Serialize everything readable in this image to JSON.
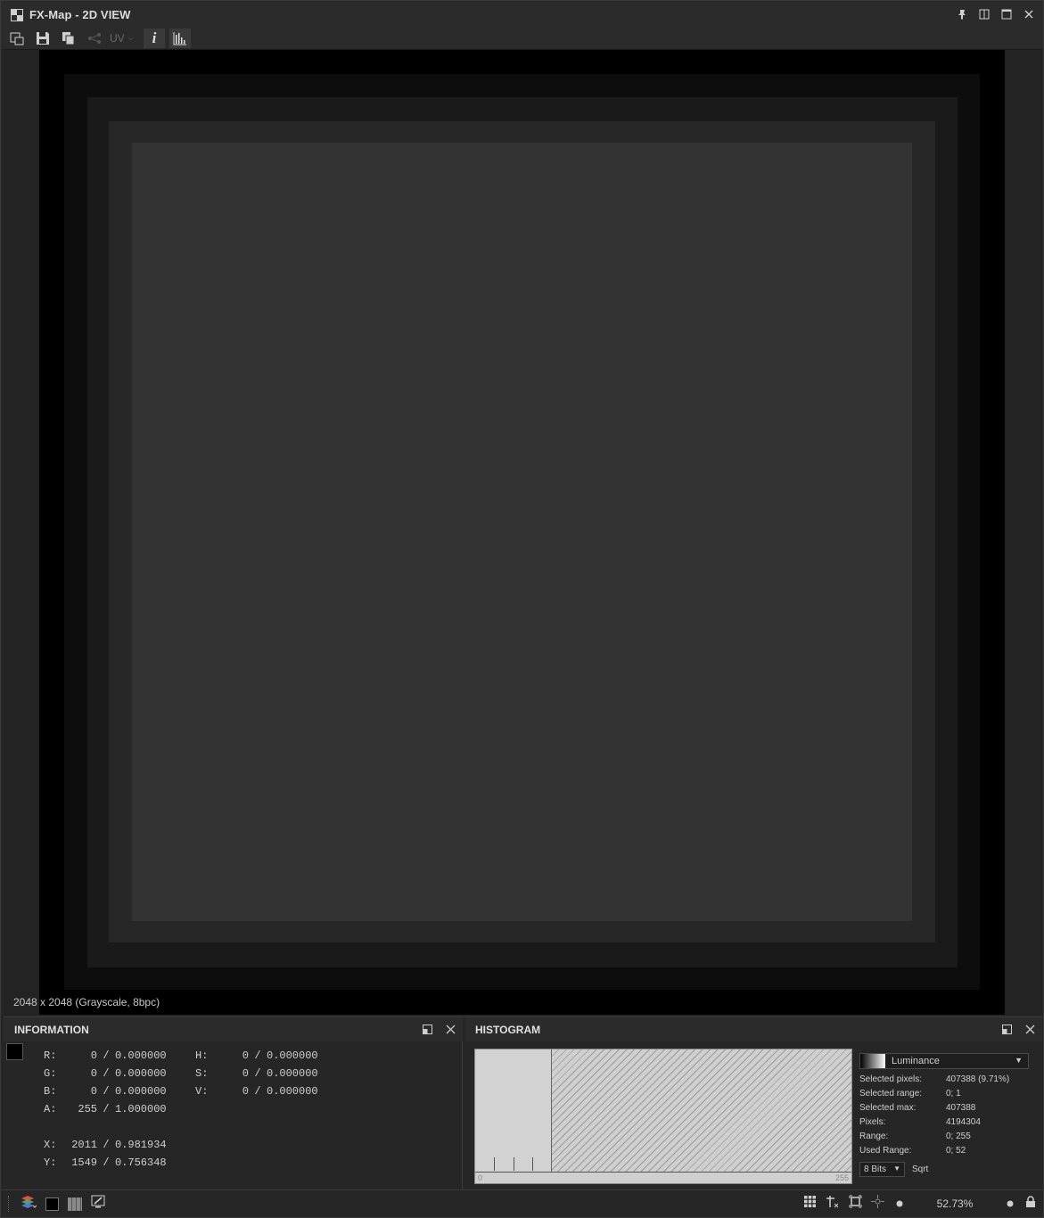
{
  "window": {
    "title": "FX-Map - 2D VIEW"
  },
  "toolbar": {
    "uv_label": "UV"
  },
  "viewport": {
    "dimensions": "2048 x 2048 (Grayscale, 8bpc)"
  },
  "information": {
    "title": "INFORMATION",
    "rows": [
      {
        "label": "R:",
        "int": "0",
        "float": "0.000000",
        "label2": "H:",
        "int2": "0",
        "float2": "0.000000"
      },
      {
        "label": "G:",
        "int": "0",
        "float": "0.000000",
        "label2": "S:",
        "int2": "0",
        "float2": "0.000000"
      },
      {
        "label": "B:",
        "int": "0",
        "float": "0.000000",
        "label2": "V:",
        "int2": "0",
        "float2": "0.000000"
      },
      {
        "label": "A:",
        "int": "255",
        "float": "1.000000"
      }
    ],
    "coords": [
      {
        "label": "X:",
        "int": "2011",
        "float": "0.981934"
      },
      {
        "label": "Y:",
        "int": "1549",
        "float": "0.756348"
      }
    ]
  },
  "histogram": {
    "title": "HISTOGRAM",
    "channel": "Luminance",
    "axis_min": "0",
    "axis_max": "255",
    "stats": [
      {
        "key": "Selected pixels:",
        "value": "407388 (9.71%)"
      },
      {
        "key": "Selected range:",
        "value": "0; 1"
      },
      {
        "key": "Selected max:",
        "value": "407388"
      },
      {
        "key": "Pixels:",
        "value": "4194304"
      },
      {
        "key": "Range:",
        "value": "0; 255"
      },
      {
        "key": "Used Range:",
        "value": "0; 52"
      }
    ],
    "bits": "8 Bits",
    "sqrt_label": "Sqrt"
  },
  "statusbar": {
    "zoom": "52.73%"
  },
  "colors": {
    "accent": "#333333",
    "background": "#262626"
  }
}
